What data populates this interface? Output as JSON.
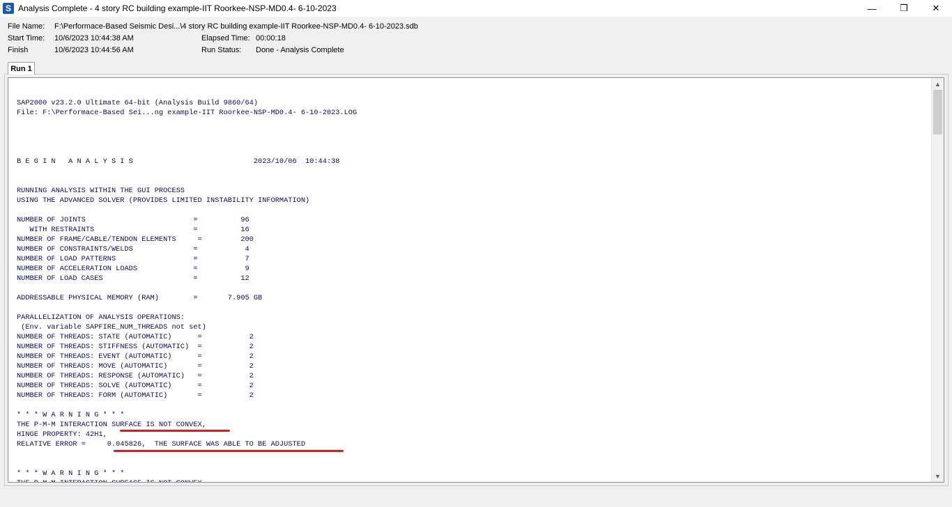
{
  "window": {
    "title": "Analysis Complete - 4 story RC building example-IIT Roorkee-NSP-MD0.4- 6-10-2023",
    "icon_letter": "S",
    "minimize": "—",
    "restore": "❐",
    "close": "✕"
  },
  "info": {
    "file_name_label": "File Name:",
    "file_name_value": "F:\\Performace-Based Seismic Desi...\\4 story RC building example-IIT Roorkee-NSP-MD0.4- 6-10-2023.sdb",
    "start_time_label": "Start Time:",
    "start_time_value": "10/6/2023  10:44:38 AM",
    "finish_label": "Finish",
    "finish_value": "10/6/2023  10:44:56 AM",
    "elapsed_label": "Elapsed Time:",
    "elapsed_value": "00:00:18",
    "run_status_label": "Run Status:",
    "run_status_value": "Done - Analysis Complete"
  },
  "tabs": [
    {
      "label": "Run 1"
    }
  ],
  "log": {
    "lines": [
      "SAP2000 v23.2.0 Ultimate 64-bit (Analysis Build 9860/64)",
      "File: F:\\Performace-Based Sei...ng example-IIT Roorkee-NSP-MD0.4- 6-10-2023.LOG",
      "",
      "",
      "",
      "",
      "B E G I N   A N A L Y S I S                            2023/10/06  10:44:38",
      "",
      "",
      "RUNNING ANALYSIS WITHIN THE GUI PROCESS",
      "USING THE ADVANCED SOLVER (PROVIDES LIMITED INSTABILITY INFORMATION)",
      "",
      "NUMBER OF JOINTS                         =          96",
      "   WITH RESTRAINTS                       =          16",
      "NUMBER OF FRAME/CABLE/TENDON ELEMENTS     =         200",
      "NUMBER OF CONSTRAINTS/WELDS              =           4",
      "NUMBER OF LOAD PATTERNS                  =           7",
      "NUMBER OF ACCELERATION LOADS             =           9",
      "NUMBER OF LOAD CASES                     =          12",
      "",
      "ADDRESSABLE PHYSICAL MEMORY (RAM)        =       7.905 GB",
      "",
      "PARALLELIZATION OF ANALYSIS OPERATIONS:",
      " (Env. variable SAPFIRE_NUM_THREADS not set)",
      "NUMBER OF THREADS: STATE (AUTOMATIC)      =           2",
      "NUMBER OF THREADS: STIFFNESS (AUTOMATIC)  =           2",
      "NUMBER OF THREADS: EVENT (AUTOMATIC)      =           2",
      "NUMBER OF THREADS: MOVE (AUTOMATIC)       =           2",
      "NUMBER OF THREADS: RESPONSE (AUTOMATIC)   =           2",
      "NUMBER OF THREADS: SOLVE (AUTOMATIC)      =           2",
      "NUMBER OF THREADS: FORM (AUTOMATIC)       =           2",
      "",
      "* * * W A R N I N G * * *",
      "THE P-M-M INTERACTION SURFACE IS NOT CONVEX,",
      "HINGE PROPERTY: 42H1,",
      "RELATIVE ERROR =     0.045826,  THE SURFACE WAS ABLE TO BE ADJUSTED",
      "",
      "",
      "* * * W A R N I N G * * *",
      "THE P-M-M INTERACTION SURFACE IS NOT CONVEX,"
    ]
  },
  "scrollbar": {
    "up": "▲",
    "down": "▼"
  },
  "colors": {
    "log_text": "#0a0a60",
    "annotation": "#d32020"
  }
}
